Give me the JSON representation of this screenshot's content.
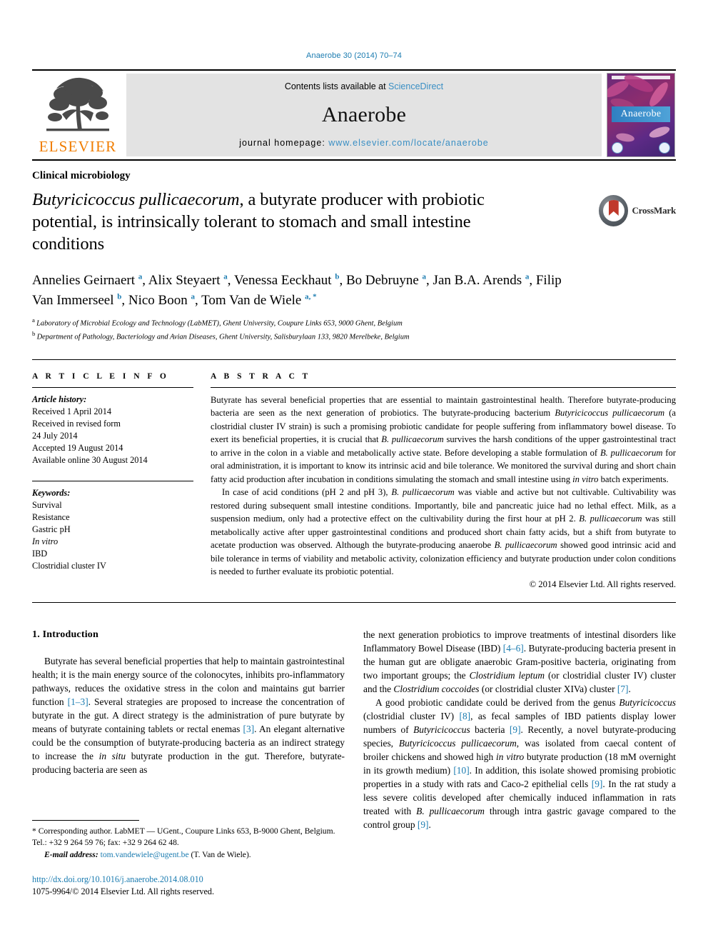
{
  "running_head": "Anaerobe 30 (2014) 70–74",
  "masthead": {
    "contents_prefix": "Contents lists available at ",
    "sciencedirect": "ScienceDirect",
    "journal_name": "Anaerobe",
    "homepage_prefix": "journal homepage: ",
    "homepage_url": "www.elsevier.com/locate/anaerobe",
    "publisher_wordmark": "ELSEVIER",
    "cover_title": "Anaerobe"
  },
  "section_label": "Clinical microbiology",
  "title": {
    "italic_lead": "Butyricicoccus pullicaecorum",
    "rest": ", a butyrate producer with probiotic potential, is intrinsically tolerant to stomach and small intestine conditions"
  },
  "crossmark": {
    "label": "CrossMark"
  },
  "authors": [
    {
      "name": "Annelies Geirnaert",
      "sup": "a",
      "sep": ", "
    },
    {
      "name": "Alix Steyaert",
      "sup": "a",
      "sep": ", "
    },
    {
      "name": "Venessa Eeckhaut",
      "sup": "b",
      "sep": ", "
    },
    {
      "name": "Bo Debruyne",
      "sup": "a",
      "sep": ", "
    },
    {
      "name": "Jan B.A. Arends",
      "sup": "a",
      "sep": ", "
    },
    {
      "name": "Filip Van Immerseel",
      "sup": "b",
      "sep": ", "
    },
    {
      "name": "Nico Boon",
      "sup": "a",
      "sep": ", "
    },
    {
      "name": "Tom Van de Wiele",
      "sup": "a, *",
      "sep": ""
    }
  ],
  "affiliations": [
    {
      "marker": "a",
      "text": "Laboratory of Microbial Ecology and Technology (LabMET), Ghent University, Coupure Links 653, 9000 Ghent, Belgium"
    },
    {
      "marker": "b",
      "text": "Department of Pathology, Bacteriology and Avian Diseases, Ghent University, Salisburylaan 133, 9820 Merelbeke, Belgium"
    }
  ],
  "article_info": {
    "heading": "A R T I C L E    I N F O",
    "history_label": "Article history:",
    "history": [
      "Received 1 April 2014",
      "Received in revised form",
      "24 July 2014",
      "Accepted 19 August 2014",
      "Available online 30 August 2014"
    ],
    "keywords_label": "Keywords:",
    "keywords": [
      "Survival",
      "Resistance",
      "Gastric pH",
      "In vitro",
      "IBD",
      "Clostridial cluster IV"
    ]
  },
  "abstract": {
    "heading": "A B S T R A C T",
    "paragraph1_parts": [
      {
        "t": "Butyrate has several beneficial properties that are essential to maintain gastrointestinal health. Therefore butyrate-producing bacteria are seen as the next generation of probiotics. The butyrate-producing bacterium "
      },
      {
        "t": "Butyricicoccus pullicaecorum",
        "i": true
      },
      {
        "t": " (a clostridial cluster IV strain) is such a promising probiotic candidate for people suffering from inflammatory bowel disease. To exert its beneficial properties, it is crucial that "
      },
      {
        "t": "B. pullicaecorum",
        "i": true
      },
      {
        "t": " survives the harsh conditions of the upper gastrointestinal tract to arrive in the colon in a viable and metabolically active state. Before developing a stable formulation of "
      },
      {
        "t": "B. pullicaecorum",
        "i": true
      },
      {
        "t": " for oral administration, it is important to know its intrinsic acid and bile tolerance. We monitored the survival during and short chain fatty acid production after incubation in conditions simulating the stomach and small intestine using "
      },
      {
        "t": "in vitro",
        "i": true
      },
      {
        "t": " batch experiments."
      }
    ],
    "paragraph2_parts": [
      {
        "t": "In case of acid conditions (pH 2 and pH 3), "
      },
      {
        "t": "B. pullicaecorum",
        "i": true
      },
      {
        "t": " was viable and active but not cultivable. Cultivability was restored during subsequent small intestine conditions. Importantly, bile and pancreatic juice had no lethal effect. Milk, as a suspension medium, only had a protective effect on the cultivability during the first hour at pH 2. "
      },
      {
        "t": "B. pullicaecorum",
        "i": true
      },
      {
        "t": " was still metabolically active after upper gastrointestinal conditions and produced short chain fatty acids, but a shift from butyrate to acetate production was observed. Although the butyrate-producing anaerobe "
      },
      {
        "t": "B. pullicaecorum",
        "i": true
      },
      {
        "t": " showed good intrinsic acid and bile tolerance in terms of viability and metabolic activity, colonization efficiency and butyrate production under colon conditions is needed to further evaluate its probiotic potential."
      }
    ],
    "copyright": "© 2014 Elsevier Ltd. All rights reserved."
  },
  "introduction": {
    "heading": "1. Introduction",
    "left_paragraph_parts": [
      {
        "t": "Butyrate has several beneficial properties that help to maintain gastrointestinal health; it is the main energy source of the colonocytes, inhibits pro-inflammatory pathways, reduces the oxidative stress in the colon and maintains gut barrier function "
      },
      {
        "t": "[1–3]",
        "ref": true
      },
      {
        "t": ". Several strategies are proposed to increase the concentration of butyrate in the gut. A direct strategy is the administration of pure butyrate by means of butyrate containing tablets or rectal enemas "
      },
      {
        "t": "[3]",
        "ref": true
      },
      {
        "t": ". An elegant alternative could be the consumption of butyrate-producing bacteria as an indirect strategy to increase the "
      },
      {
        "t": "in situ",
        "i": true
      },
      {
        "t": " butyrate production in the gut. Therefore, butyrate-producing bacteria are seen as"
      }
    ],
    "right_paragraph1_parts": [
      {
        "t": "the next generation probiotics to improve treatments of intestinal disorders like Inflammatory Bowel Disease (IBD) "
      },
      {
        "t": "[4–6]",
        "ref": true
      },
      {
        "t": ". Butyrate-producing bacteria present in the human gut are obligate anaerobic Gram-positive bacteria, originating from two important groups; the "
      },
      {
        "t": "Clostridium leptum",
        "i": true
      },
      {
        "t": " (or clostridial cluster IV) cluster and the "
      },
      {
        "t": "Clostridium coccoides",
        "i": true
      },
      {
        "t": " (or clostridial cluster XIVa) cluster "
      },
      {
        "t": "[7]",
        "ref": true
      },
      {
        "t": "."
      }
    ],
    "right_paragraph2_parts": [
      {
        "t": "A good probiotic candidate could be derived from the genus "
      },
      {
        "t": "Butyricicoccus",
        "i": true
      },
      {
        "t": " (clostridial cluster IV) "
      },
      {
        "t": "[8]",
        "ref": true
      },
      {
        "t": ", as fecal samples of IBD patients display lower numbers of "
      },
      {
        "t": "Butyricicoccus",
        "i": true
      },
      {
        "t": " bacteria "
      },
      {
        "t": "[9]",
        "ref": true
      },
      {
        "t": ". Recently, a novel butyrate-producing species, "
      },
      {
        "t": "Butyricicoccus pullicaecorum",
        "i": true
      },
      {
        "t": ", was isolated from caecal content of broiler chickens and showed high "
      },
      {
        "t": "in vitro",
        "i": true
      },
      {
        "t": " butyrate production (18 mM overnight in its growth medium) "
      },
      {
        "t": "[10]",
        "ref": true
      },
      {
        "t": ". In addition, this isolate showed promising probiotic properties in a study with rats and Caco-2 epithelial cells "
      },
      {
        "t": "[9]",
        "ref": true
      },
      {
        "t": ". In the rat study a less severe colitis developed after chemically induced inflammation in rats treated with "
      },
      {
        "t": "B. pullicaecorum",
        "i": true
      },
      {
        "t": " through intra gastric gavage compared to the control group "
      },
      {
        "t": "[9]",
        "ref": true
      },
      {
        "t": "."
      }
    ]
  },
  "footnote": {
    "corresponding": "* Corresponding author. LabMET — UGent., Coupure Links 653, B-9000 Ghent, Belgium. Tel.: +32 9 264 59 76; fax: +32 9 264 62 48.",
    "email_label": "E-mail address:",
    "email": "tom.vandewiele@ugent.be",
    "email_suffix": "(T. Van de Wiele).",
    "doi": "http://dx.doi.org/10.1016/j.anaerobe.2014.08.010",
    "issn_line": "1075-9964/© 2014 Elsevier Ltd. All rights reserved."
  },
  "colors": {
    "link": "#1a7bb0",
    "elsevier_orange": "#f07d00",
    "band_gray": "#e3e3e3"
  }
}
